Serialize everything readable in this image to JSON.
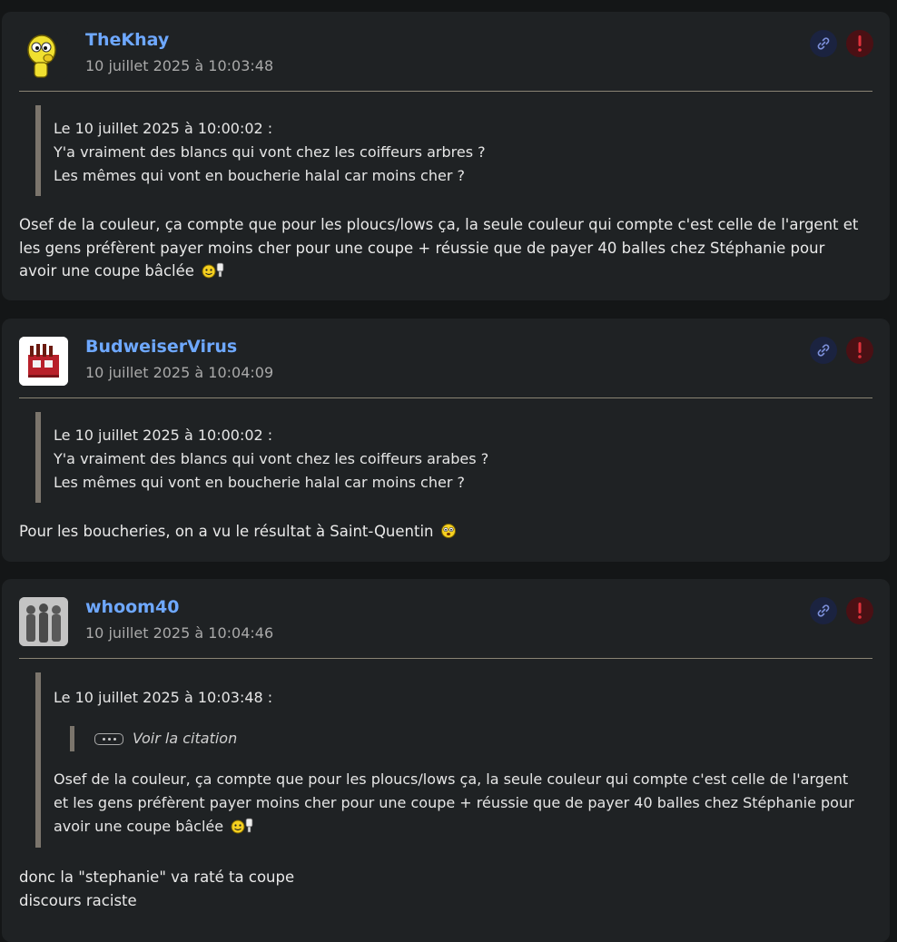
{
  "posts": [
    {
      "author": "TheKhay",
      "date": "10 juillet 2025 à 10:03:48",
      "quote": {
        "header": "Le 10 juillet 2025 à 10:00:02 :",
        "lines": [
          "Y'a vraiment des blancs qui vont chez les coiffeurs arbres ?",
          "Les mêmes qui vont en boucherie halal car moins cher ?"
        ]
      },
      "body": "Osef de la couleur, ça compte que pour les ploucs/lows ça, la seule couleur qui compte c'est celle de l'argent et les gens préfèrent payer moins cher pour une coupe + réussie que de payer 40 balles chez Stéphanie pour avoir une coupe bâclée",
      "body_emoji": "ahi-smiley-icon"
    },
    {
      "author": "BudweiserVirus",
      "date": "10 juillet 2025 à 10:04:09",
      "quote": {
        "header": "Le 10 juillet 2025 à 10:00:02 :",
        "lines": [
          "Y'a vraiment des blancs qui vont chez les coiffeurs arabes ?",
          "Les mêmes qui vont en boucherie halal car moins cher ?"
        ]
      },
      "body": "Pour les boucheries, on a vu le résultat à Saint-Quentin",
      "body_emoji": "bave-smiley-icon"
    },
    {
      "author": "whoom40",
      "date": "10 juillet 2025 à 10:04:46",
      "quote": {
        "header": "Le 10 juillet 2025 à 10:03:48 :",
        "nested_label": "Voir la citation",
        "text": "Osef de la couleur, ça compte que pour les ploucs/lows ça, la seule couleur qui compte c'est celle de l'argent et les gens préfèrent payer moins cher pour une coupe + réussie que de payer 40 balles chez Stéphanie pour avoir une coupe bâclée"
      },
      "body_lines": [
        "donc la \"stephanie\" va raté ta coupe",
        "discours raciste"
      ]
    }
  ],
  "colors": {
    "author": "#6ea8ff",
    "card": "#1f2224",
    "page": "#141617",
    "report": "#e0323c",
    "link": "#7c8fd9"
  }
}
